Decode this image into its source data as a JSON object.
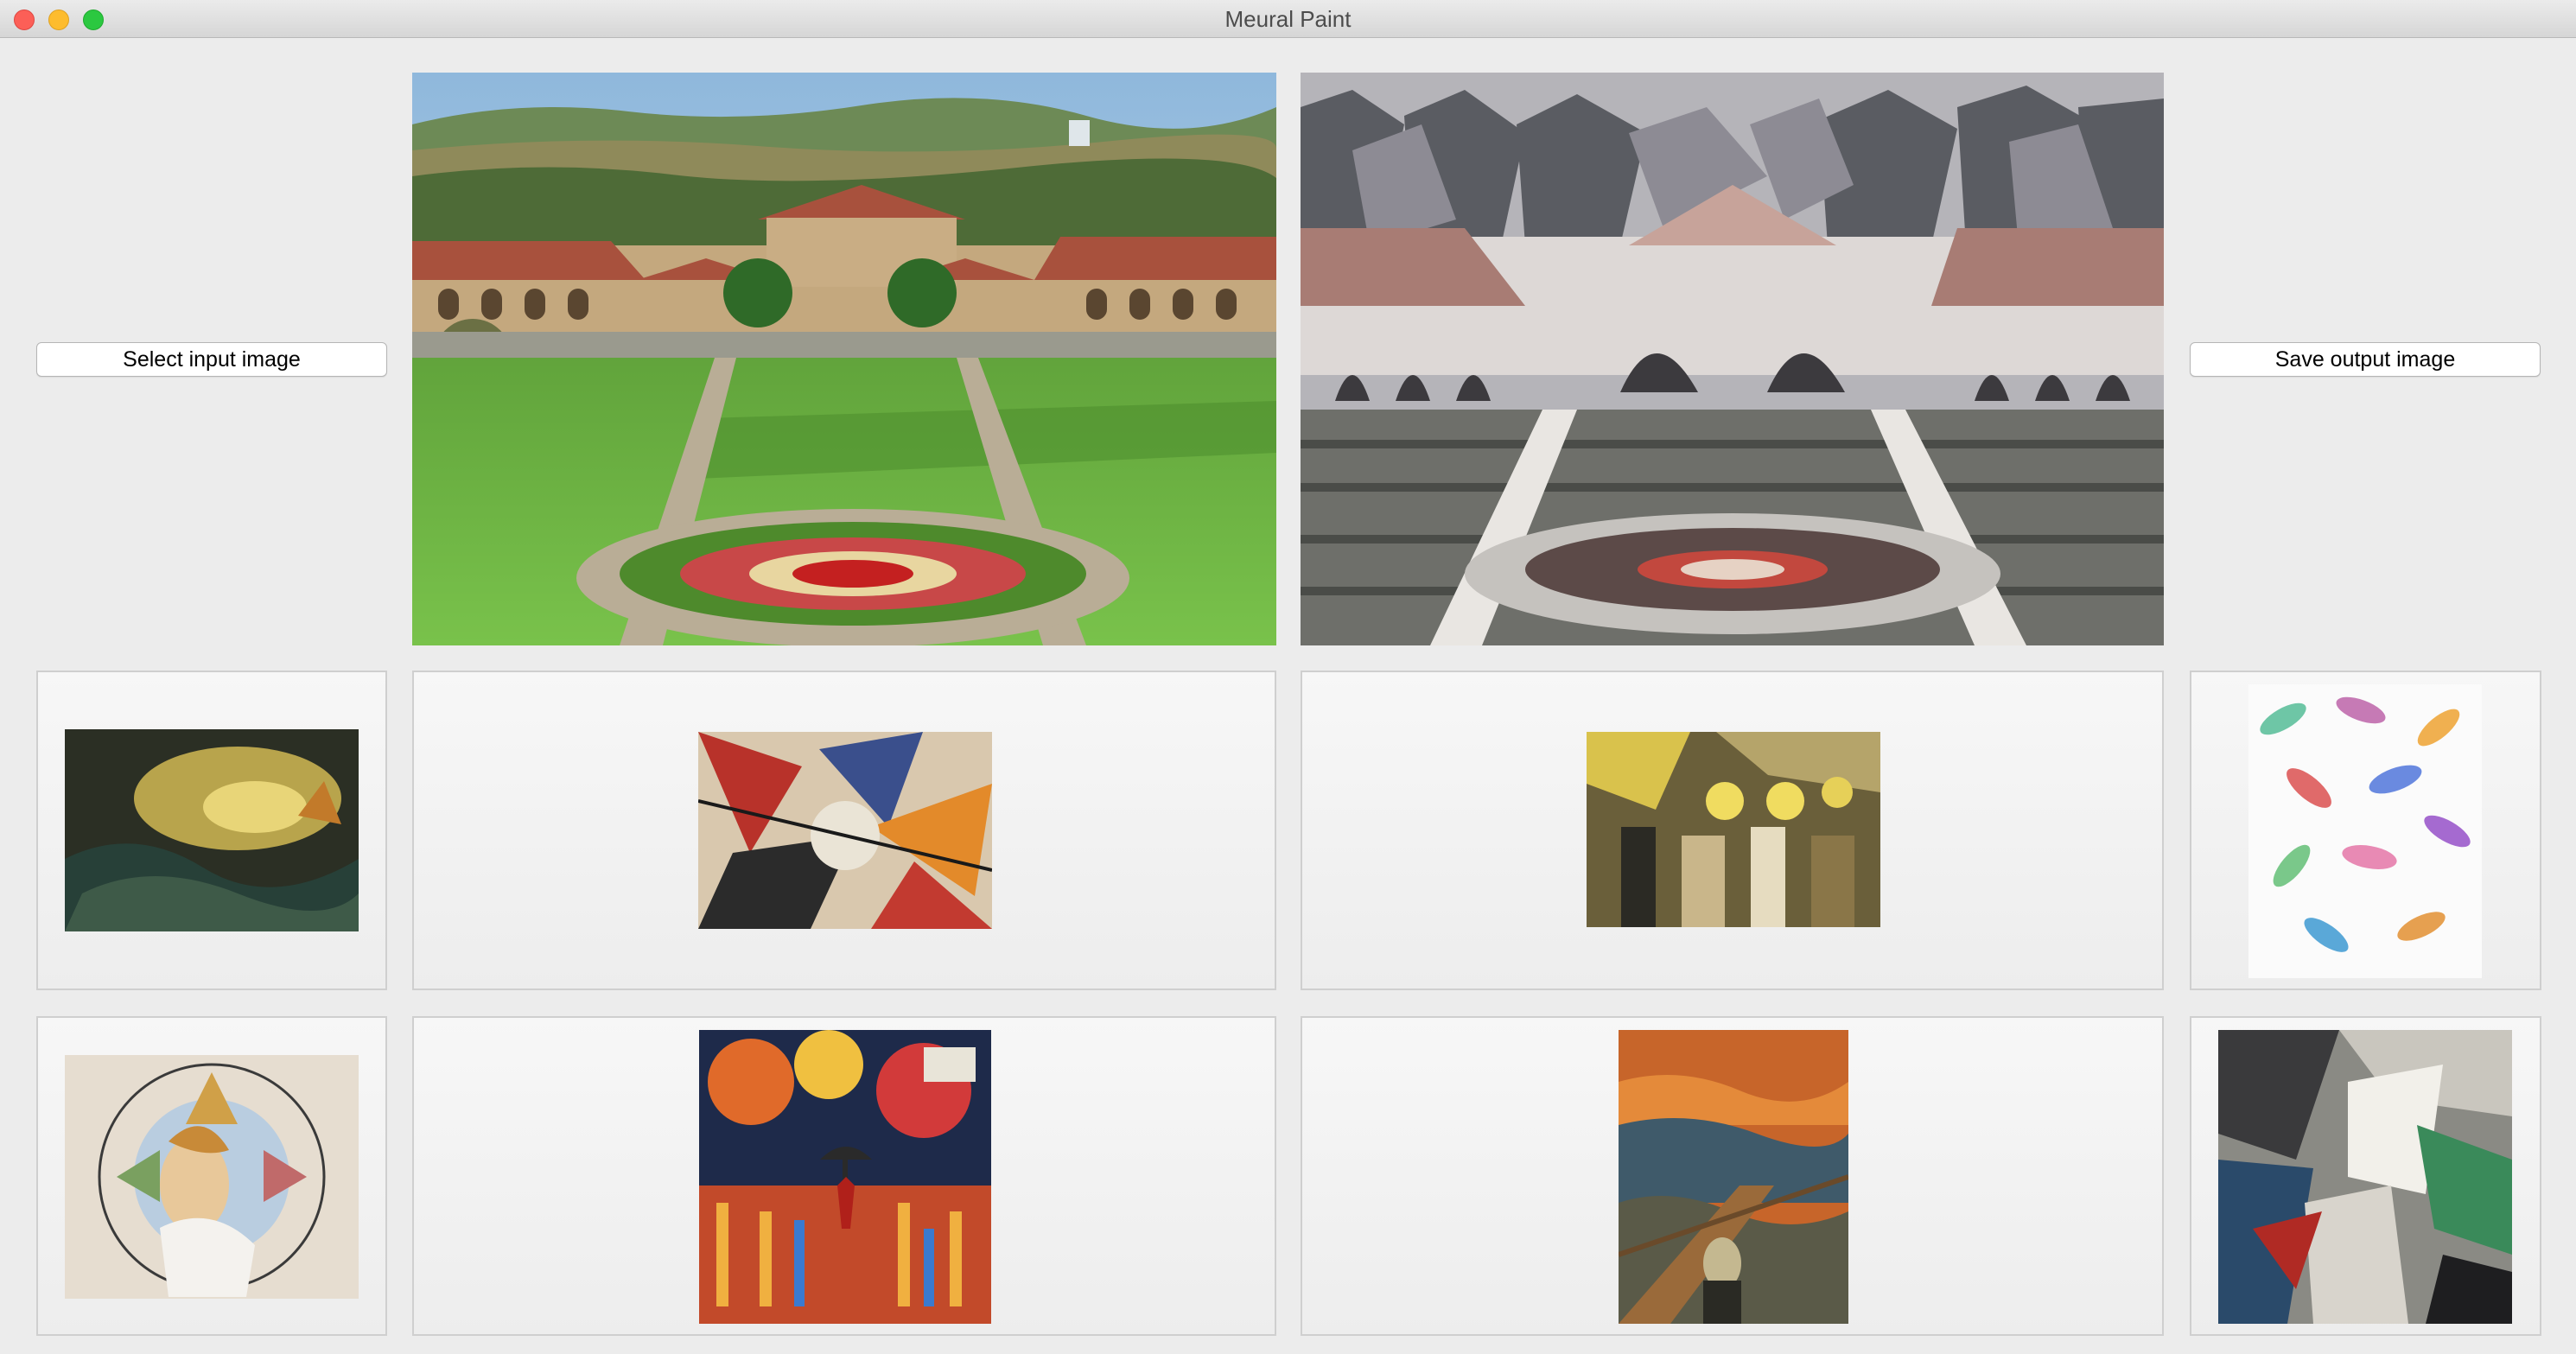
{
  "window": {
    "title": "Meural Paint"
  },
  "controls": {
    "select_input_label": "Select input image",
    "save_output_label": "Save output image"
  },
  "images": {
    "input_photo": "stanford-main-quad-photo",
    "output_photo": "stylized-main-quad-output"
  },
  "style_tiles": [
    {
      "id": "turner-shipwreck",
      "row": 1,
      "col": 1
    },
    {
      "id": "kandinsky-composition",
      "row": 1,
      "col": 2
    },
    {
      "id": "cubist-village",
      "row": 1,
      "col": 3
    },
    {
      "id": "watercolor-leaves",
      "row": 1,
      "col": 4
    },
    {
      "id": "stained-glass-mucha",
      "row": 2,
      "col": 1
    },
    {
      "id": "afremov-rain-umbrella",
      "row": 2,
      "col": 2
    },
    {
      "id": "munch-the-scream",
      "row": 2,
      "col": 3
    },
    {
      "id": "cubist-figure",
      "row": 2,
      "col": 4
    }
  ],
  "colors": {
    "window_bg": "#ececec",
    "close": "#fc5f57",
    "minimize": "#fdbc2e",
    "maximize": "#2bc840"
  }
}
